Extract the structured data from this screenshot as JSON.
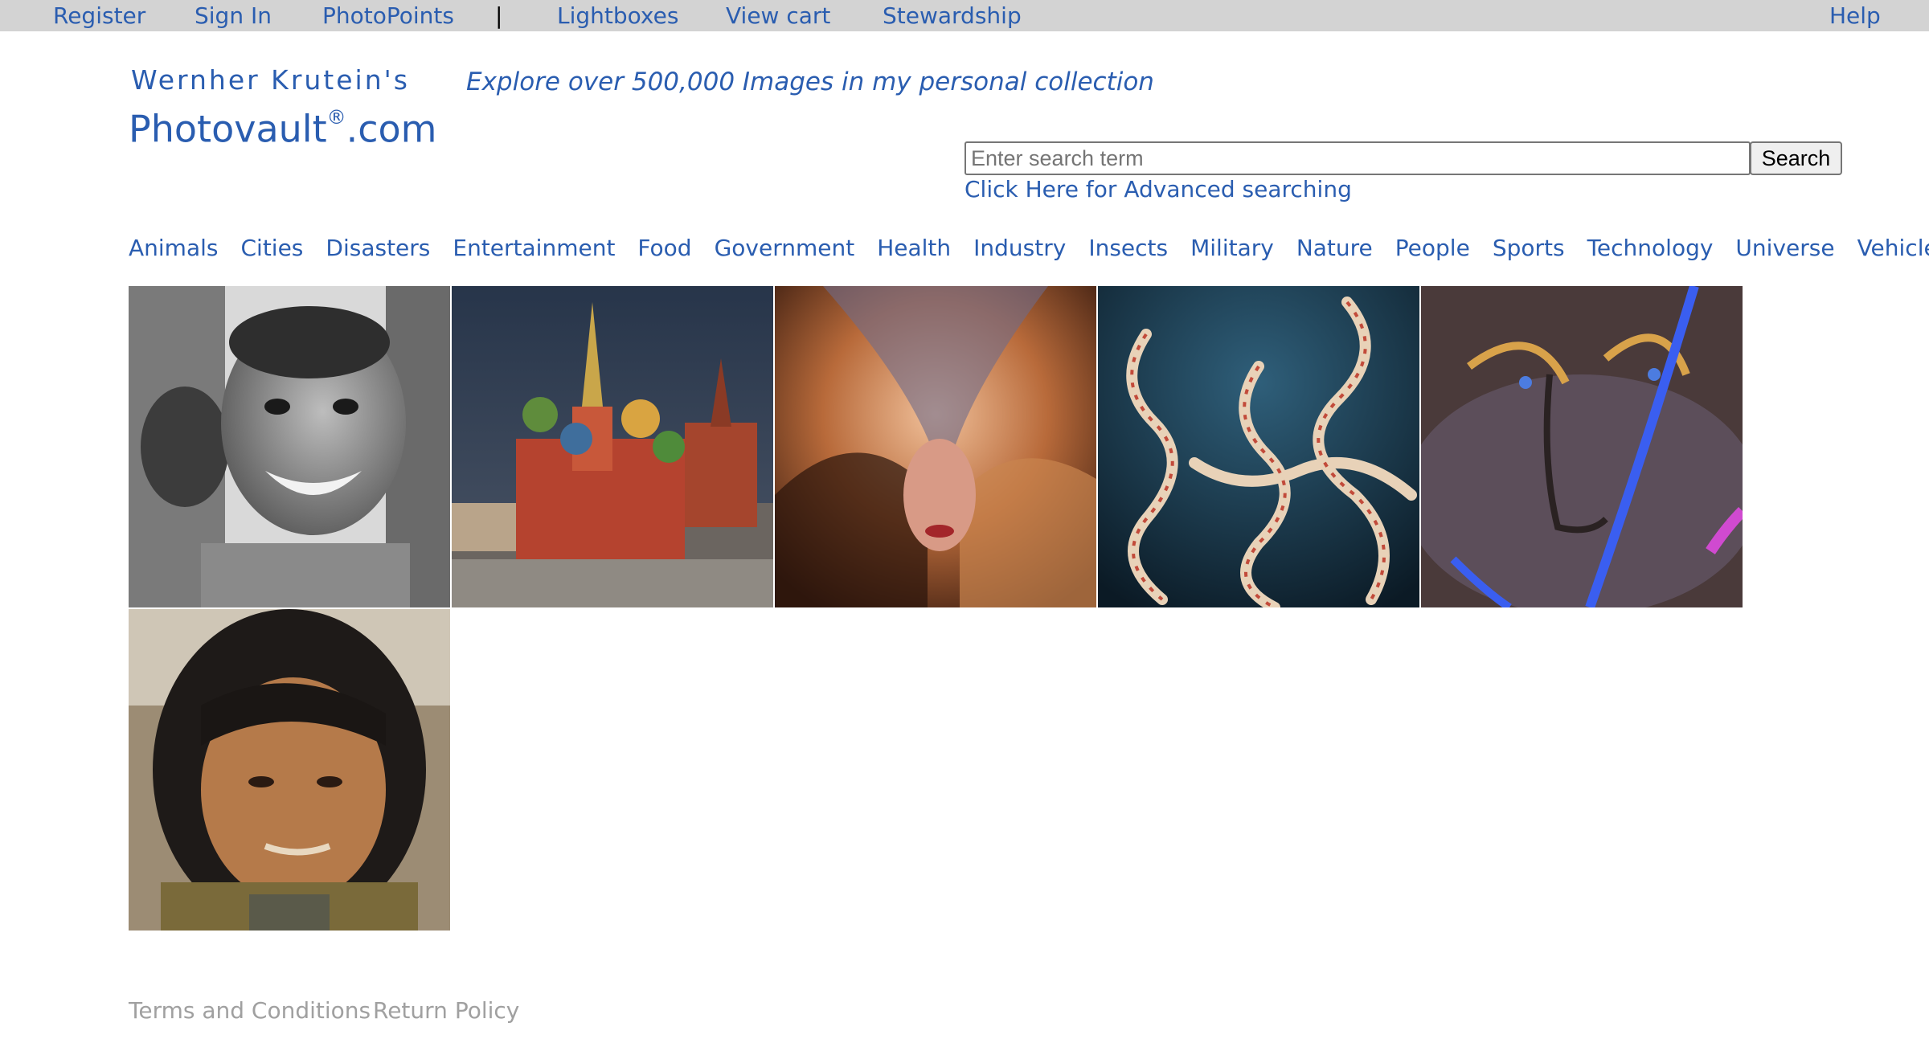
{
  "topnav": {
    "register": "Register",
    "sign_in": "Sign In",
    "photopoints": "PhotoPoints",
    "separator": "|",
    "lightboxes": "Lightboxes",
    "view_cart": "View cart",
    "stewardship": "Stewardship",
    "help": "Help"
  },
  "brand": {
    "owner": "Wernher Krutein's",
    "site_name": "Photovault",
    "registered": "®",
    "domain": ".com",
    "tagline": "Explore over 500,000 Images in my personal collection"
  },
  "search": {
    "placeholder": "Enter search term",
    "value": "",
    "button_label": "Search",
    "advanced_link": "Click Here for Advanced searching"
  },
  "categories": [
    "Animals",
    "Cities",
    "Disasters",
    "Entertainment",
    "Food",
    "Government",
    "Health",
    "Industry",
    "Insects",
    "Military",
    "Nature",
    "People",
    "Sports",
    "Technology",
    "Universe",
    "Vehicles"
  ],
  "gallery": [
    {
      "icon": "smiling-child-photo"
    },
    {
      "icon": "st-basils-cathedral-photo"
    },
    {
      "icon": "abstract-face-photo"
    },
    {
      "icon": "brittle-star-photo"
    },
    {
      "icon": "light-painting-face-photo"
    },
    {
      "icon": "man-portrait-photo"
    }
  ],
  "footer": {
    "terms": "Terms and Conditions",
    "returns": "Return Policy"
  },
  "colors": {
    "link": "#2a5db0",
    "topbar_bg": "#d3d3d3",
    "footer_text": "#a0a0a0"
  }
}
